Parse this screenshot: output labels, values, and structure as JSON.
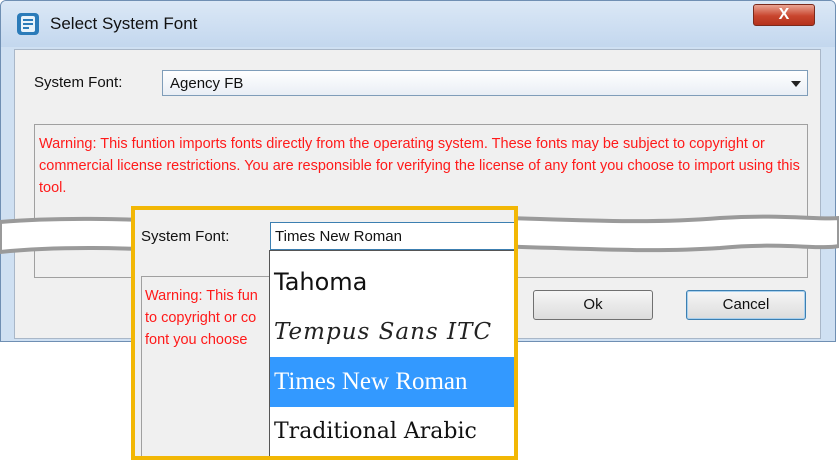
{
  "window": {
    "title": "Select System Font",
    "close_glyph": "X",
    "icon": "app-logo-icon"
  },
  "form": {
    "font_label": "System Font:",
    "selected_font": "Agency FB",
    "warning": "Warning: This funtion imports fonts directly from the operating system.  These fonts may be subject to copyright or commercial license restrictions.  You are responsible for verifying the license of any font you choose to import using this tool.",
    "ok_label": "Ok",
    "cancel_label": "Cancel"
  },
  "zoom": {
    "font_label": "System Font:",
    "selected_font": "Times New Roman",
    "warning_lines": [
      "Warning: This fun",
      "to copyright or co",
      "font you choose"
    ],
    "options": [
      "Tahoma",
      "Tempus Sans ITC",
      "Times New Roman",
      "Traditional Arabic"
    ],
    "highlighted_option": "Times New Roman"
  },
  "colors": {
    "warning_text": "#ff1a1a",
    "highlight": "#3399ff",
    "callout_border": "#f2b705",
    "title_bar": "#c3d7ee"
  }
}
